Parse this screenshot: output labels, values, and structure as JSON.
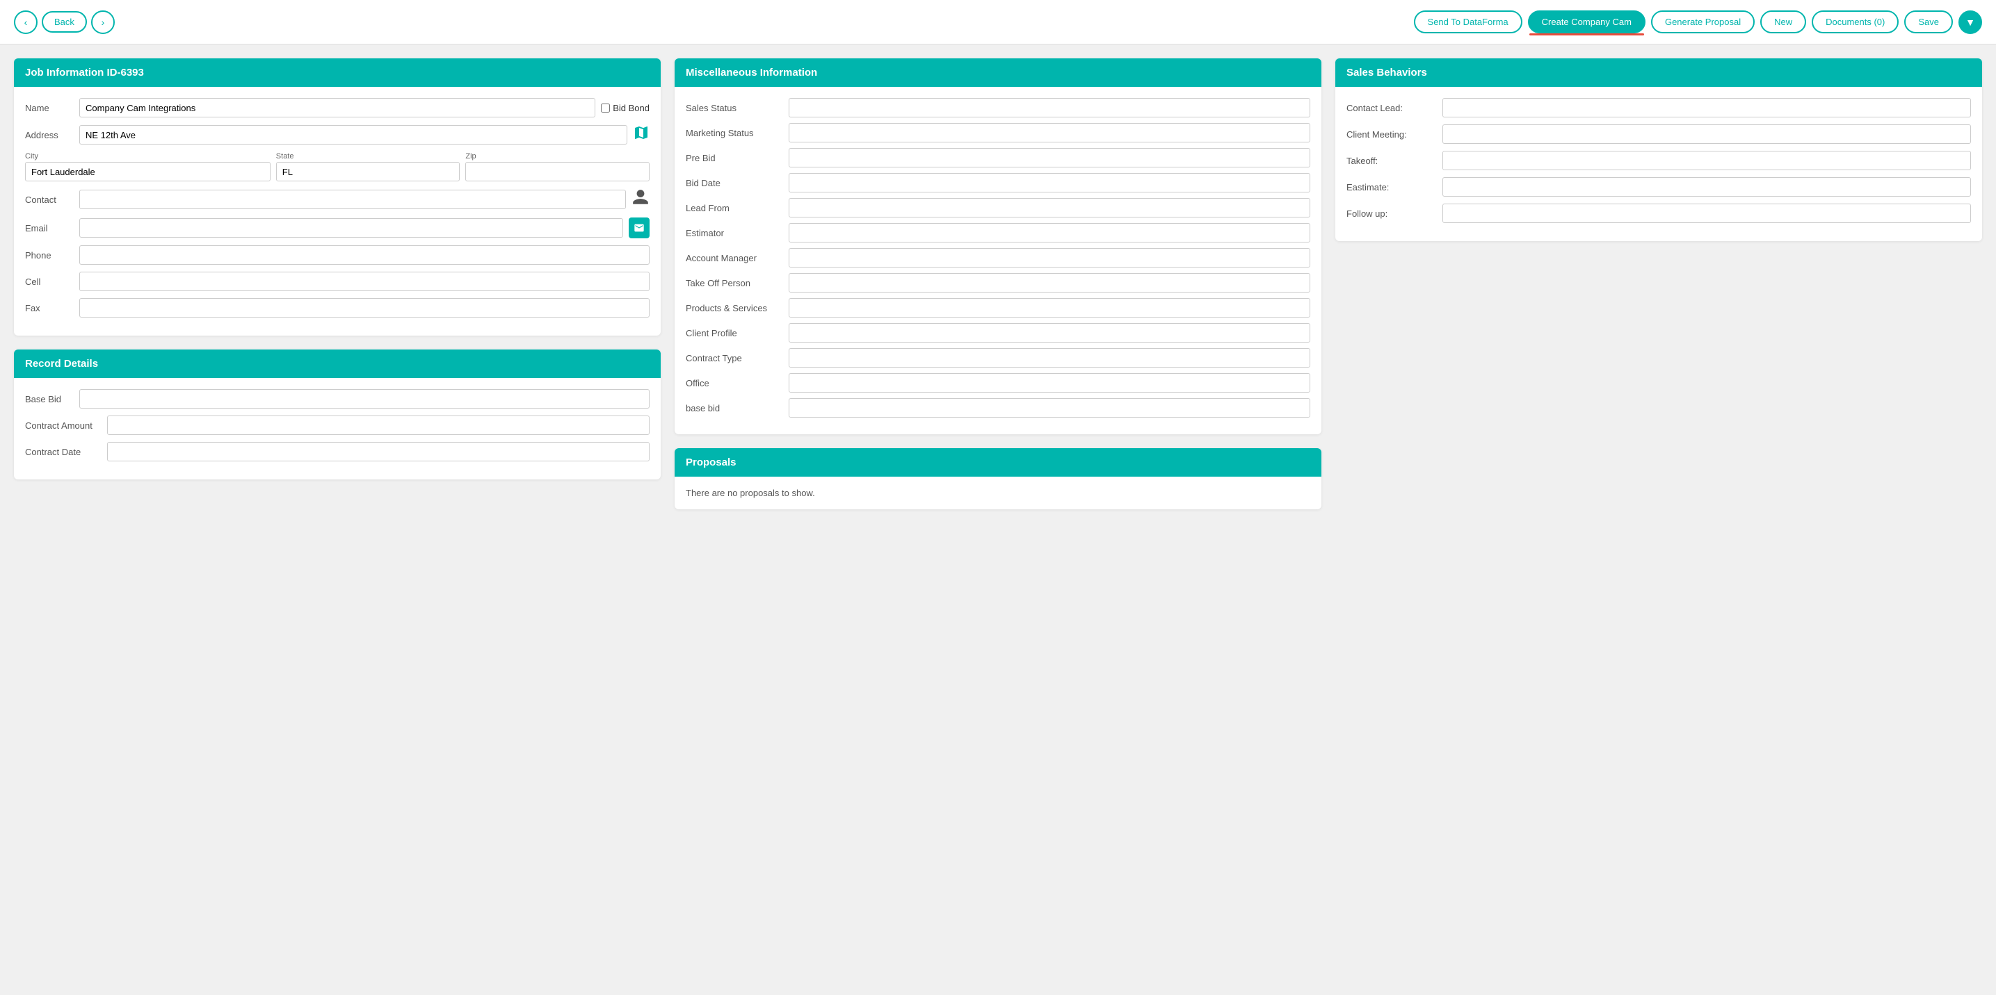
{
  "topbar": {
    "back_label": "Back",
    "send_to_dataforma_label": "Send To DataForma",
    "create_company_cam_label": "Create Company Cam",
    "generate_proposal_label": "Generate Proposal",
    "new_label": "New",
    "documents_label": "Documents (0)",
    "save_label": "Save",
    "dropdown_icon": "▾"
  },
  "job_info": {
    "panel_title": "Job Information ID-6393",
    "name_label": "Name",
    "name_value": "Company Cam Integrations",
    "bid_bond_label": "Bid Bond",
    "address_label": "Address",
    "address_value": "NE 12th Ave",
    "city_label": "City",
    "city_value": "Fort Lauderdale",
    "state_label": "State",
    "state_value": "FL",
    "zip_label": "Zip",
    "zip_value": "",
    "contact_label": "Contact",
    "contact_value": "",
    "email_label": "Email",
    "email_value": "",
    "phone_label": "Phone",
    "phone_value": "",
    "cell_label": "Cell",
    "cell_value": "",
    "fax_label": "Fax",
    "fax_value": ""
  },
  "misc_info": {
    "panel_title": "Miscellaneous Information",
    "fields": [
      {
        "label": "Sales Status",
        "value": ""
      },
      {
        "label": "Marketing Status",
        "value": ""
      },
      {
        "label": "Pre Bid",
        "value": ""
      },
      {
        "label": "Bid Date",
        "value": ""
      },
      {
        "label": "Lead From",
        "value": ""
      },
      {
        "label": "Estimator",
        "value": ""
      },
      {
        "label": "Account Manager",
        "value": ""
      },
      {
        "label": "Take Off Person",
        "value": ""
      },
      {
        "label": "Products & Services",
        "value": ""
      },
      {
        "label": "Client Profile",
        "value": ""
      },
      {
        "label": "Contract Type",
        "value": ""
      },
      {
        "label": "Office",
        "value": ""
      },
      {
        "label": "base bid",
        "value": ""
      }
    ]
  },
  "sales_behaviors": {
    "panel_title": "Sales Behaviors",
    "fields": [
      {
        "label": "Contact Lead:",
        "value": ""
      },
      {
        "label": "Client Meeting:",
        "value": ""
      },
      {
        "label": "Takeoff:",
        "value": ""
      },
      {
        "label": "Eastimate:",
        "value": ""
      },
      {
        "label": "Follow up:",
        "value": ""
      }
    ]
  },
  "record_details": {
    "panel_title": "Record Details",
    "fields": [
      {
        "label": "Base Bid",
        "value": ""
      },
      {
        "label": "Contract Amount",
        "value": ""
      },
      {
        "label": "Contract Date",
        "value": ""
      }
    ]
  },
  "proposals": {
    "panel_title": "Proposals",
    "empty_message": "There are no proposals to show."
  }
}
